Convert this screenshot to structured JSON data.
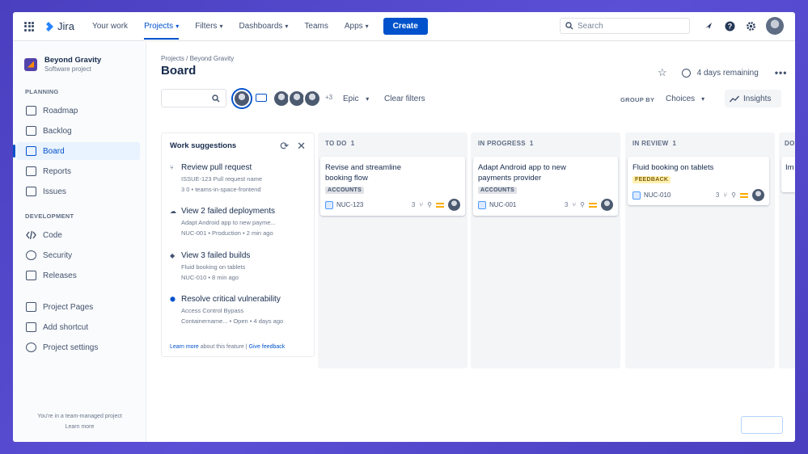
{
  "nav": {
    "logo_text": "Jira",
    "items": [
      {
        "label": "Your work"
      },
      {
        "label": "Projects"
      },
      {
        "label": "Filters"
      },
      {
        "label": "Dashboards"
      },
      {
        "label": "Teams"
      },
      {
        "label": "Apps"
      }
    ],
    "create_label": "Create",
    "search_placeholder": "Search"
  },
  "sidebar": {
    "project_name": "Beyond Gravity",
    "project_type": "Software project",
    "planning_heading": "PLANNING",
    "planning_items": [
      {
        "label": "Roadmap"
      },
      {
        "label": "Backlog"
      },
      {
        "label": "Board"
      },
      {
        "label": "Reports"
      },
      {
        "label": "Issues"
      }
    ],
    "development_heading": "DEVELOPMENT",
    "development_items": [
      {
        "label": "Code"
      },
      {
        "label": "Security"
      },
      {
        "label": "Releases"
      }
    ],
    "other_items": [
      {
        "label": "Project Pages"
      },
      {
        "label": "Add shortcut"
      },
      {
        "label": "Project settings"
      }
    ],
    "footer_text": "You're in a team-managed project",
    "footer_link": "Learn more"
  },
  "header": {
    "breadcrumb": "Projects / Beyond Gravity",
    "title": "Board",
    "remaining": "4 days remaining"
  },
  "filters": {
    "more_count": "+3",
    "epic_label": "Epic",
    "clear_label": "Clear filters",
    "group_by_label": "GROUP BY",
    "choices_label": "Choices",
    "insights_label": "Insights"
  },
  "suggestions": {
    "title": "Work suggestions",
    "items": [
      {
        "title": "Review pull request",
        "line1": "ISSUE-123 Pull request name",
        "line2": "3  0 • teams-in-space-frontend"
      },
      {
        "title": "View 2 failed deployments",
        "line1": "Adapt Android app to new payme...",
        "line2": "NUC-001 • Production • 2 min ago"
      },
      {
        "title": "View 3 failed builds",
        "line1": "Fluid booking on tablets",
        "line2": "NUC-010 • 8 min ago"
      },
      {
        "title": "Resolve critical vulnerability",
        "line1": "Access Control Bypass",
        "line2": "Containername... • Open • 4 days ago"
      }
    ],
    "footer_learn": "Learn more",
    "footer_mid": " about this feature | ",
    "footer_feedback": "Give feedback"
  },
  "columns": [
    {
      "name": "TO DO",
      "count": "1",
      "cards": [
        {
          "title": "Revise and streamline booking flow",
          "label": "ACCOUNTS",
          "key": "NUC-123",
          "points": "3"
        }
      ]
    },
    {
      "name": "IN PROGRESS",
      "count": "1",
      "cards": [
        {
          "title": "Adapt Android app to new payments provider",
          "label": "ACCOUNTS",
          "key": "NUC-001",
          "points": "3"
        }
      ]
    },
    {
      "name": "IN REVIEW",
      "count": "1",
      "cards": [
        {
          "title": "Fluid booking on tablets",
          "label": "FEEDBACK",
          "key": "NUC-010",
          "points": "3"
        }
      ]
    },
    {
      "name": "DO",
      "count": "",
      "cards": [
        {
          "title": "Im",
          "label": "",
          "key": "",
          "points": ""
        }
      ]
    }
  ]
}
